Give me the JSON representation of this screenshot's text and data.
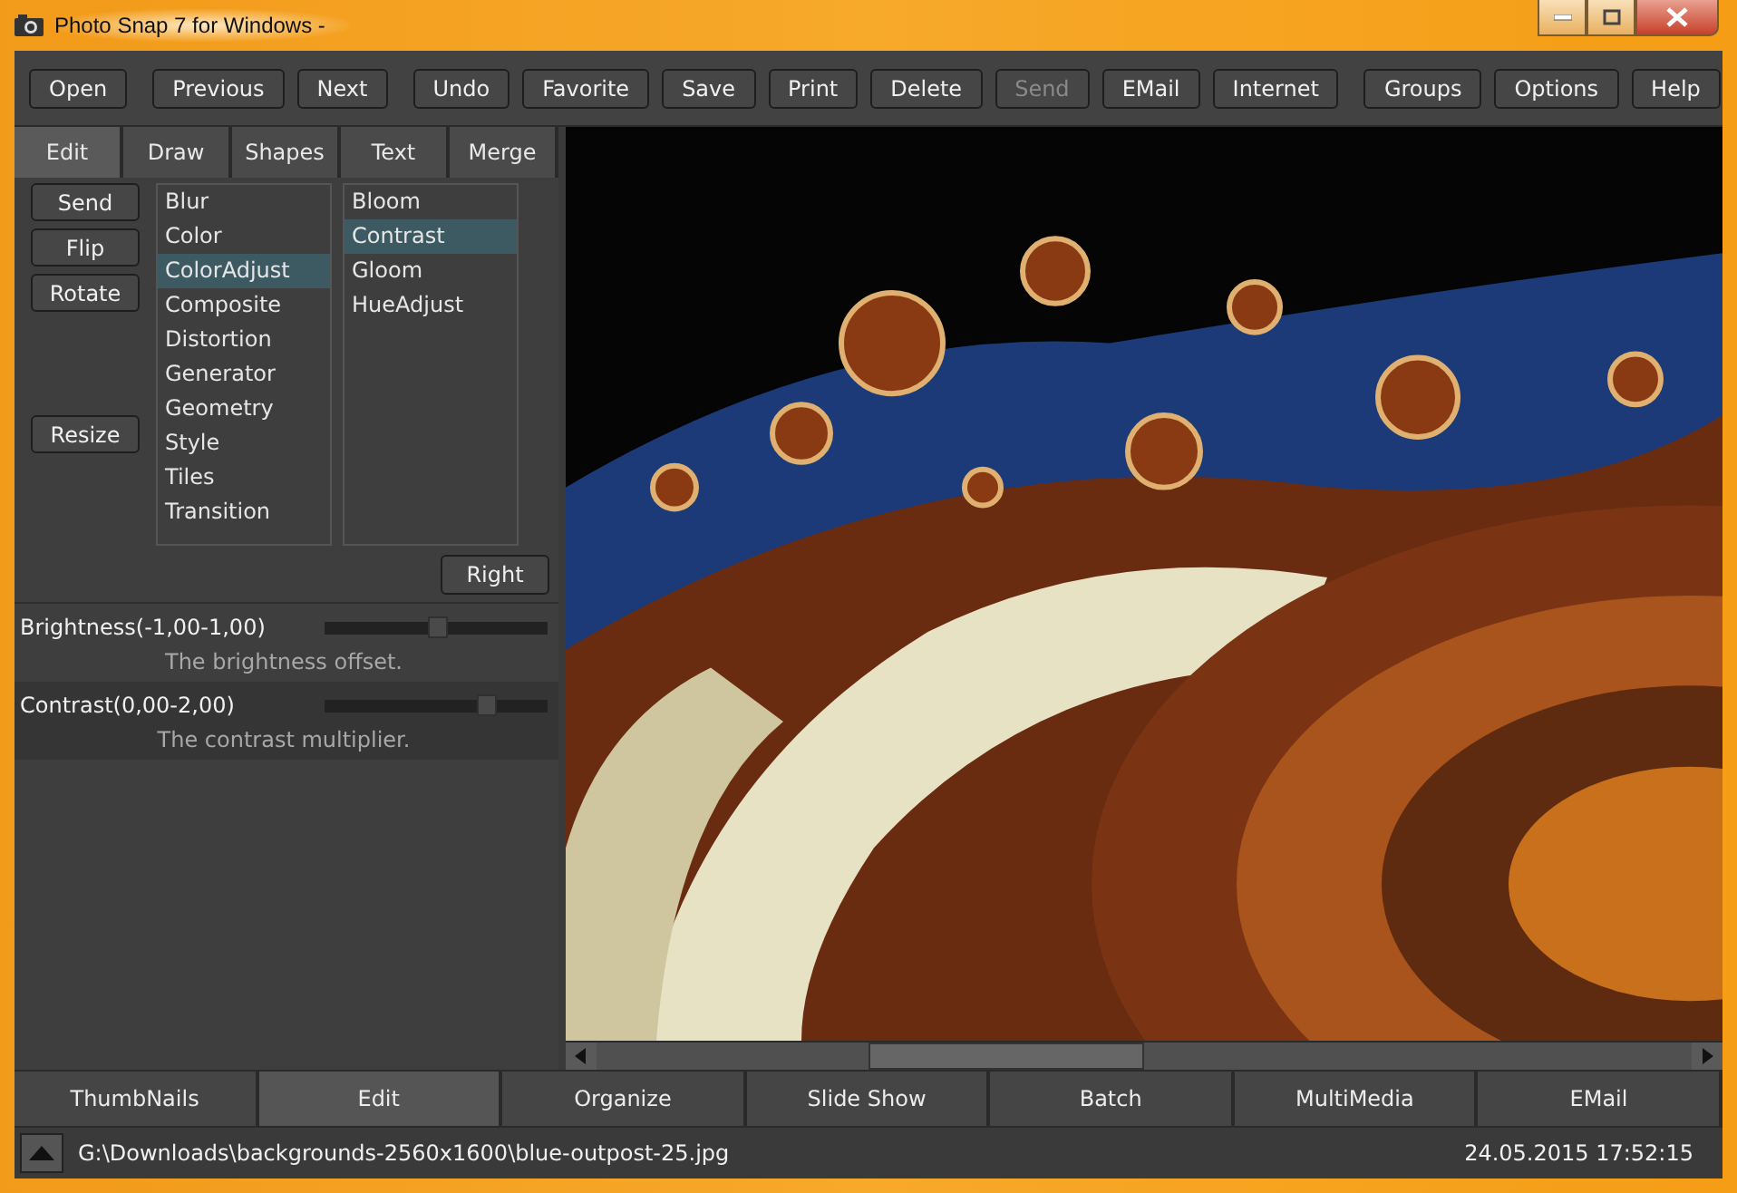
{
  "window": {
    "title": "Photo Snap 7 for Windows -"
  },
  "toolbar_groups": [
    [
      {
        "label": "Open",
        "disabled": false
      }
    ],
    [
      {
        "label": "Previous",
        "disabled": false
      },
      {
        "label": "Next",
        "disabled": false
      }
    ],
    [
      {
        "label": "Undo",
        "disabled": false
      },
      {
        "label": "Favorite",
        "disabled": false
      },
      {
        "label": "Save",
        "disabled": false
      },
      {
        "label": "Print",
        "disabled": false
      },
      {
        "label": "Delete",
        "disabled": false
      },
      {
        "label": "Send",
        "disabled": true
      },
      {
        "label": "EMail",
        "disabled": false
      },
      {
        "label": "Internet",
        "disabled": false
      }
    ],
    [
      {
        "label": "Groups",
        "disabled": false
      },
      {
        "label": "Options",
        "disabled": false
      },
      {
        "label": "Help",
        "disabled": false
      }
    ]
  ],
  "panel_tabs": [
    {
      "label": "Edit",
      "selected": true
    },
    {
      "label": "Draw",
      "selected": false
    },
    {
      "label": "Shapes",
      "selected": false
    },
    {
      "label": "Text",
      "selected": false
    },
    {
      "label": "Merge",
      "selected": false
    }
  ],
  "action_buttons": [
    {
      "label": "Send",
      "kind": "top"
    },
    {
      "label": "Flip",
      "kind": "top"
    },
    {
      "label": "Rotate",
      "kind": "top"
    },
    {
      "label": "Resize",
      "kind": "bottom"
    }
  ],
  "categories": [
    {
      "label": "Blur",
      "selected": false
    },
    {
      "label": "Color",
      "selected": false
    },
    {
      "label": "ColorAdjust",
      "selected": true
    },
    {
      "label": "Composite",
      "selected": false
    },
    {
      "label": "Distortion",
      "selected": false
    },
    {
      "label": "Generator",
      "selected": false
    },
    {
      "label": "Geometry",
      "selected": false
    },
    {
      "label": "Style",
      "selected": false
    },
    {
      "label": "Tiles",
      "selected": false
    },
    {
      "label": "Transition",
      "selected": false
    }
  ],
  "effects": [
    {
      "label": "Bloom",
      "selected": false
    },
    {
      "label": "Contrast",
      "selected": true
    },
    {
      "label": "Gloom",
      "selected": false
    },
    {
      "label": "HueAdjust",
      "selected": false
    }
  ],
  "right_button": "Right",
  "parameters": [
    {
      "name": "Brightness(-1,00-1,00)",
      "description": "The brightness offset.",
      "level": 0.5
    },
    {
      "name": "Contrast(0,00-2,00)",
      "description": "The contrast multiplier.",
      "level": 0.72
    }
  ],
  "image": {
    "kind": "picture"
  },
  "bottom_tabs": [
    {
      "label": "ThumbNails",
      "selected": false
    },
    {
      "label": "Edit",
      "selected": true
    },
    {
      "label": "Organize",
      "selected": false
    },
    {
      "label": "Slide Show",
      "selected": false
    },
    {
      "label": "Batch",
      "selected": false
    },
    {
      "label": "MultiMedia",
      "selected": false
    },
    {
      "label": "EMail",
      "selected": false
    }
  ],
  "status_bar": {
    "path": "G:\\Downloads\\backgrounds-2560x1600\\blue-outpost-25.jpg",
    "datetime": "24.05.2015 17:52:15"
  }
}
